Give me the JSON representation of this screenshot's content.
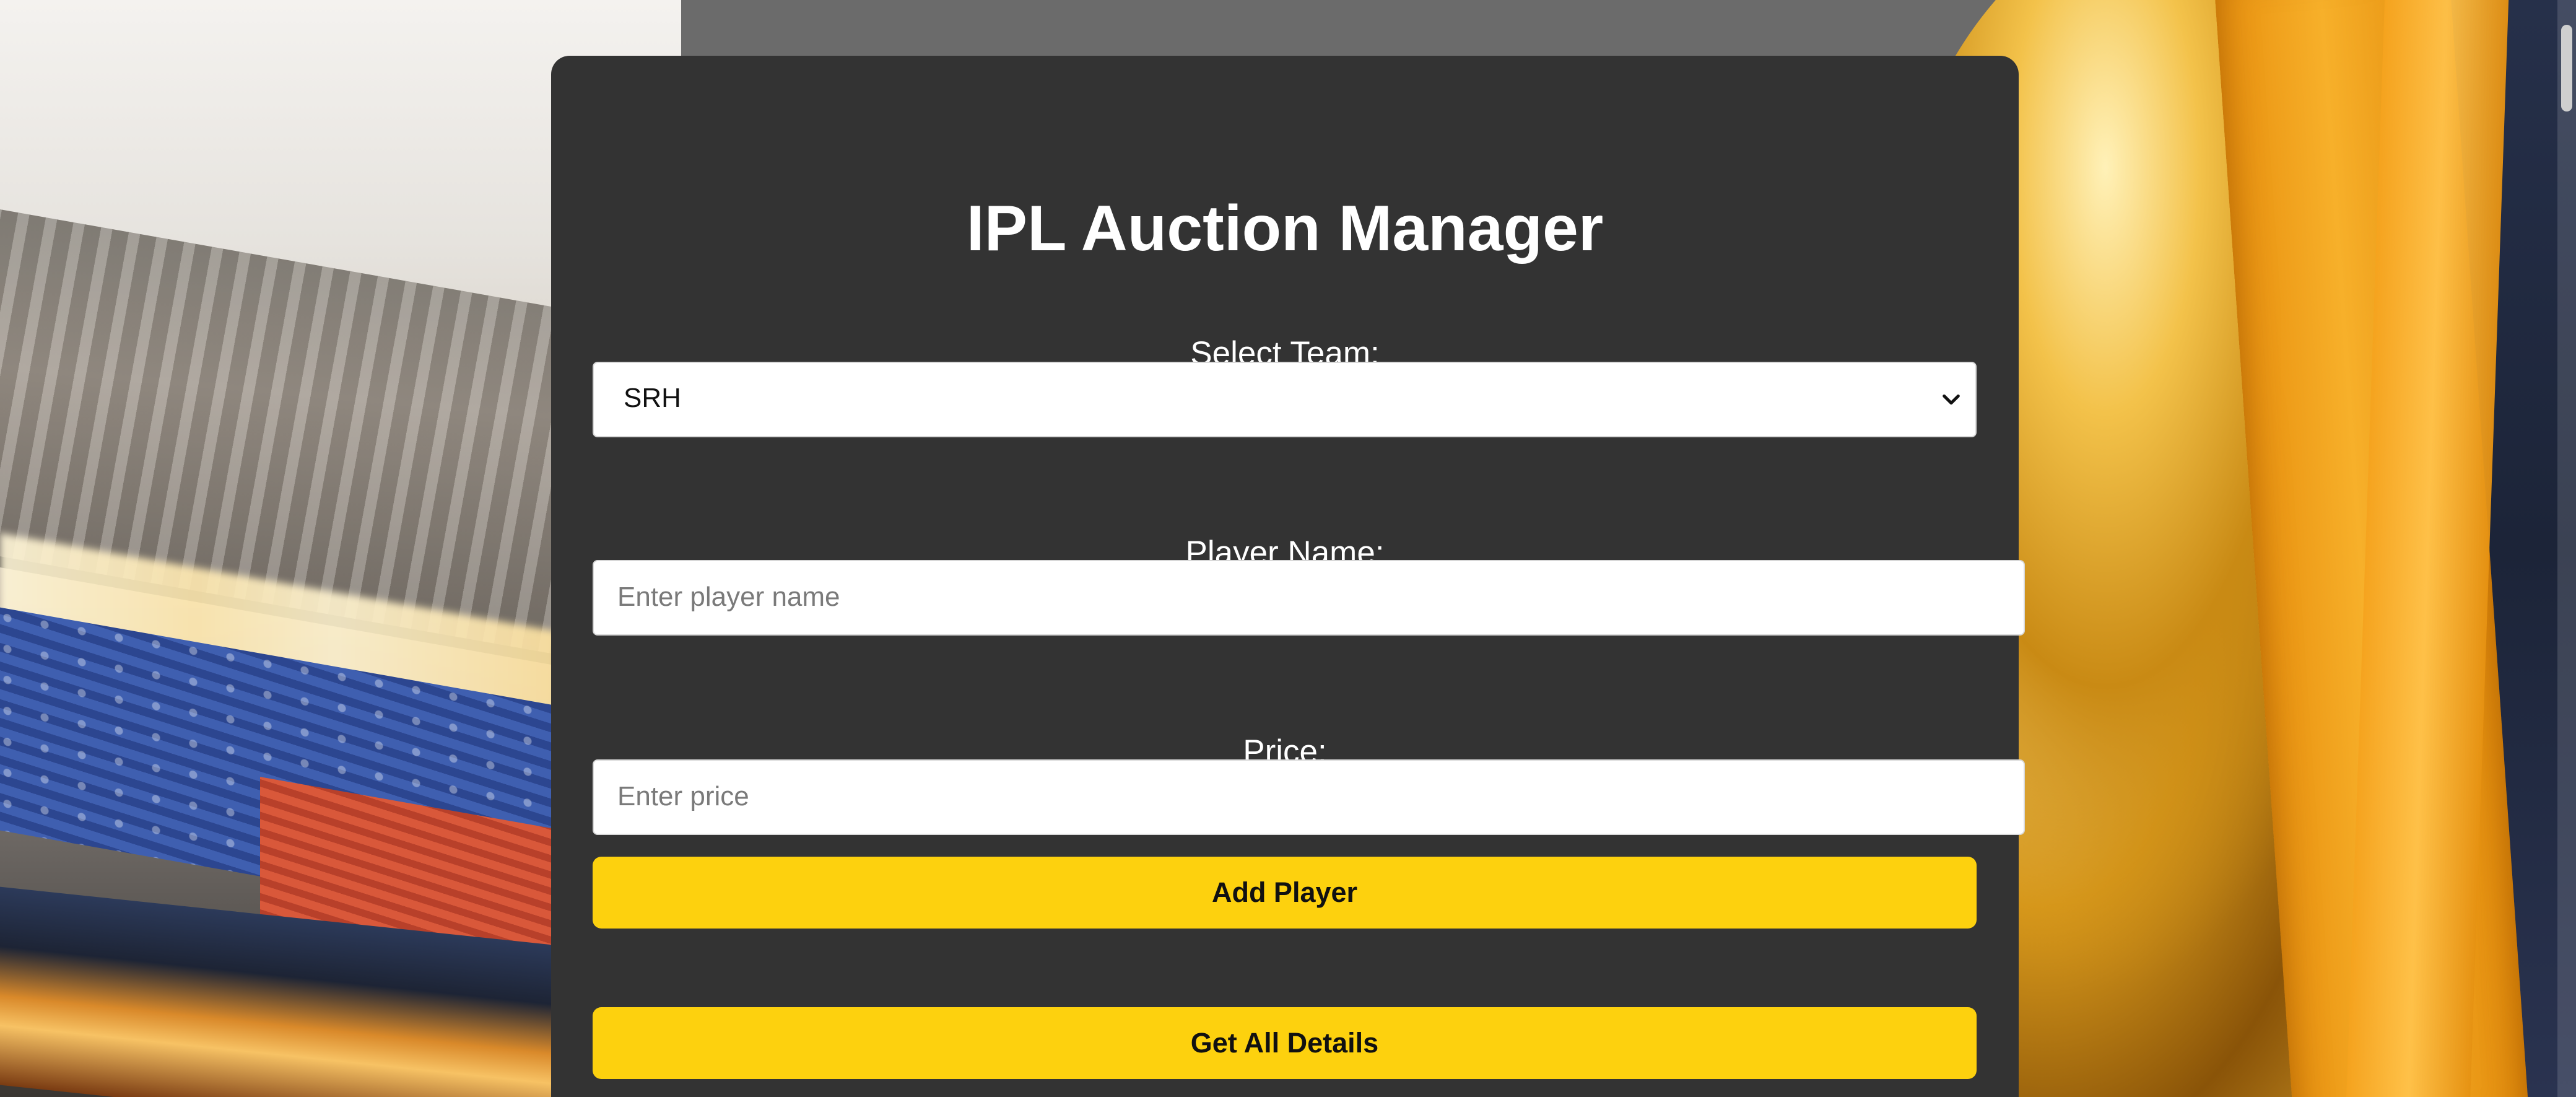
{
  "app": {
    "title": "IPL Auction Manager"
  },
  "form": {
    "team_label": "Select Team:",
    "team_selected": "SRH",
    "player_label": "Player Name:",
    "player_placeholder": "Enter player name",
    "player_value": "",
    "price_label": "Price:",
    "price_placeholder": "Enter price",
    "price_value": ""
  },
  "buttons": {
    "add_player": "Add Player",
    "get_all_details": "Get All Details"
  },
  "colors": {
    "card_background": "#333333",
    "button_accent": "#fdd10e",
    "title_text": "#ffffff"
  },
  "icons": {
    "select_indicator": "chevron-down-icon"
  }
}
